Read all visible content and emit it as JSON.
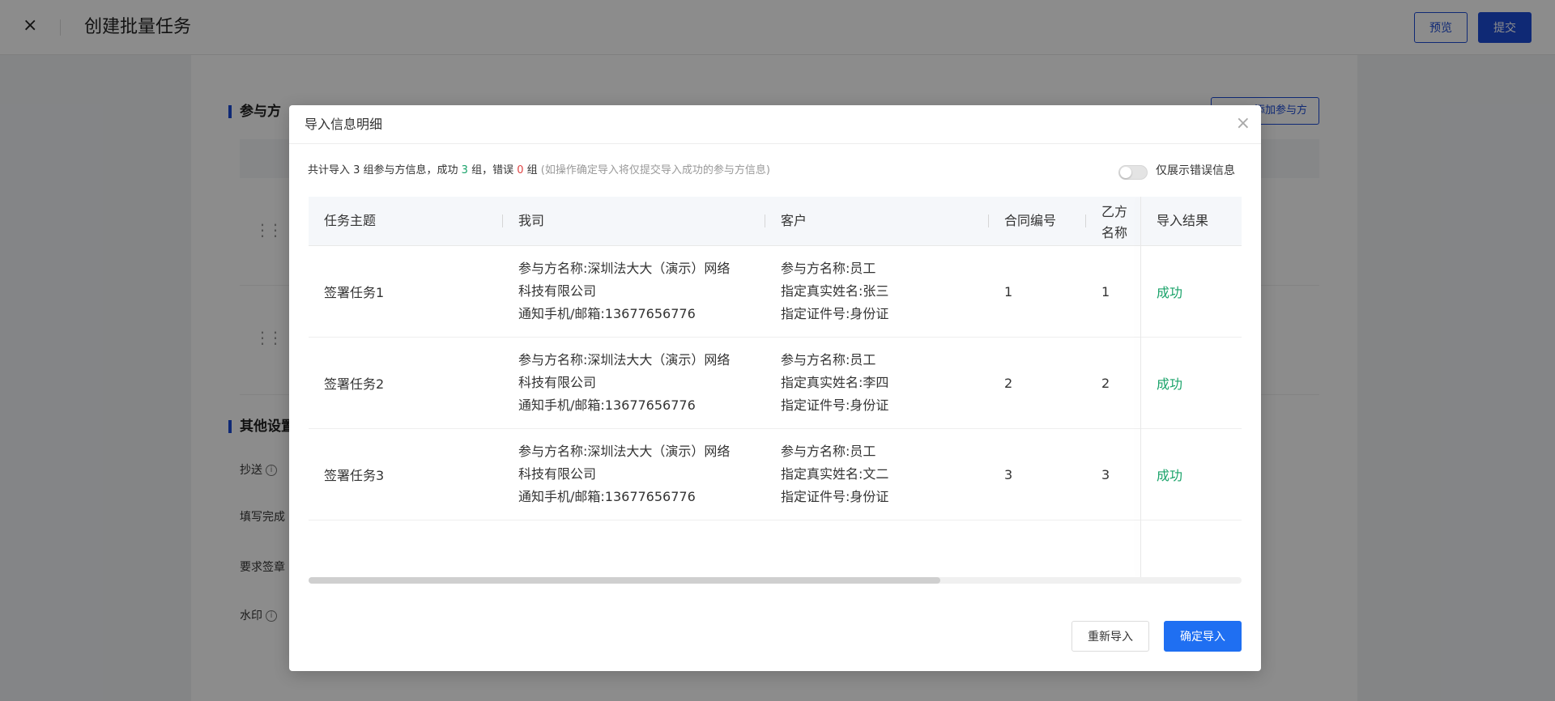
{
  "page": {
    "title": "创建批量任务",
    "close_icon": "×",
    "preview_label": "预览",
    "submit_label": "提交",
    "section_participants": "参与方",
    "add_participant_label": "添加参与方",
    "section_other": "其他设置",
    "cc_label": "抄送",
    "fill_label": "填写完成",
    "seal_label": "要求签章",
    "watermark_label": "水印"
  },
  "modal": {
    "title": "导入信息明细",
    "close_icon": "×",
    "summary": {
      "prefix": "共计导入 3 组参与方信息，成功 ",
      "success_count": "3",
      "middle": " 组，错误 ",
      "error_count": "0",
      "suffix": " 组",
      "note": "(如操作确定导入将仅提交导入成功的参与方信息)"
    },
    "toggle_label": "仅展示错误信息",
    "toggle_on": false,
    "columns": {
      "task": "任务主题",
      "company": "我司",
      "customer": "客户",
      "contract": "合同编号",
      "party_b_line1": "乙方",
      "party_b_line2": "名称",
      "result": "导入结果"
    },
    "rows": [
      {
        "task": "签署任务1",
        "company": [
          "参与方名称:深圳法大大（演示）网络",
          "科技有限公司",
          "通知手机/邮箱:13677656776"
        ],
        "customer": [
          "参与方名称:员工",
          "指定真实姓名:张三",
          "指定证件号:身份证"
        ],
        "contract": "1",
        "party_b": "1",
        "result": "成功"
      },
      {
        "task": "签署任务2",
        "company": [
          "参与方名称:深圳法大大（演示）网络",
          "科技有限公司",
          "通知手机/邮箱:13677656776"
        ],
        "customer": [
          "参与方名称:员工",
          "指定真实姓名:李四",
          "指定证件号:身份证"
        ],
        "contract": "2",
        "party_b": "2",
        "result": "成功"
      },
      {
        "task": "签署任务3",
        "company": [
          "参与方名称:深圳法大大（演示）网络",
          "科技有限公司",
          "通知手机/邮箱:13677656776"
        ],
        "customer": [
          "参与方名称:员工",
          "指定真实姓名:文二",
          "指定证件号:身份证"
        ],
        "contract": "3",
        "party_b": "3",
        "result": "成功"
      }
    ],
    "scroll_position": 0.68,
    "reimport_label": "重新导入",
    "confirm_label": "确定导入"
  },
  "colors": {
    "primary": "#1d4bd6",
    "confirm": "#1f6ff2",
    "success": "#1aa36a",
    "error": "#e04242"
  }
}
